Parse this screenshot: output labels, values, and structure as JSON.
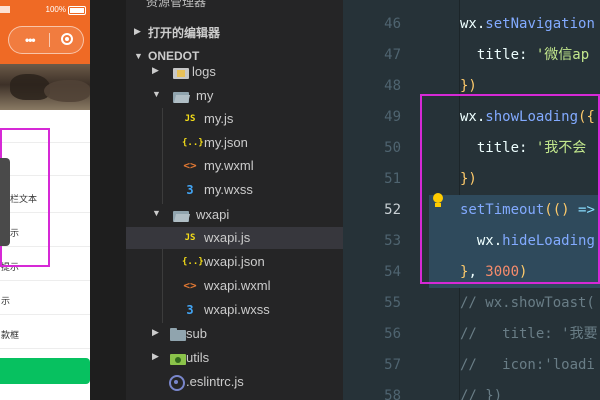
{
  "phone": {
    "battery_text": "100%",
    "list_items": [
      "",
      "",
      "题栏文本",
      "提示",
      "提示",
      "示",
      "款框"
    ]
  },
  "explorer": {
    "section_truncated": "资源管理器",
    "open_editors": "打开的编辑器",
    "project": "ONEDOT",
    "tree": [
      {
        "name": "logs",
        "type": "folder-logs",
        "expanded": false
      },
      {
        "name": "my",
        "type": "folder",
        "expanded": true
      },
      {
        "name": "my.js",
        "type": "js"
      },
      {
        "name": "my.json",
        "type": "json"
      },
      {
        "name": "my.wxml",
        "type": "wxml"
      },
      {
        "name": "my.wxss",
        "type": "wxss"
      },
      {
        "name": "wxapi",
        "type": "folder",
        "expanded": true
      },
      {
        "name": "wxapi.js",
        "type": "js",
        "selected": true
      },
      {
        "name": "wxapi.json",
        "type": "json"
      },
      {
        "name": "wxapi.wxml",
        "type": "wxml"
      },
      {
        "name": "wxapi.wxss",
        "type": "wxss"
      },
      {
        "name": "sub",
        "type": "folder",
        "expanded": false
      },
      {
        "name": "utils",
        "type": "folder-utils",
        "expanded": false
      },
      {
        "name": ".eslintrc.js",
        "type": "eslint"
      }
    ]
  },
  "editor": {
    "active_line": "52",
    "lines": [
      {
        "num": "46",
        "parts": [
          [
            "fn-prefix",
            "wx."
          ],
          [
            "fn",
            "setNavigation"
          ]
        ]
      },
      {
        "num": "47",
        "parts": [
          [
            "id",
            "  title: "
          ],
          [
            "str",
            "'微信ap"
          ]
        ]
      },
      {
        "num": "48",
        "parts": [
          [
            "b",
            "})"
          ]
        ]
      },
      {
        "num": "49",
        "parts": [
          [
            "fn-prefix",
            "wx."
          ],
          [
            "fn",
            "showLoading"
          ],
          [
            "b",
            "({"
          ]
        ]
      },
      {
        "num": "50",
        "parts": [
          [
            "id",
            "  title: "
          ],
          [
            "str",
            "'我不会"
          ]
        ]
      },
      {
        "num": "51",
        "parts": [
          [
            "b",
            "})"
          ]
        ]
      },
      {
        "num": "52",
        "parts": [
          [
            "fn",
            "setTimeout"
          ],
          [
            "b",
            "("
          ],
          [
            "b",
            "() "
          ],
          [
            "p",
            "=>"
          ]
        ],
        "sel": true
      },
      {
        "num": "53",
        "parts": [
          [
            "fn-prefix",
            "  wx."
          ],
          [
            "fn",
            "hideLoading"
          ]
        ],
        "sel": true
      },
      {
        "num": "54",
        "parts": [
          [
            "b",
            "}"
          ],
          [
            "id",
            ", "
          ],
          [
            "num",
            "3000"
          ],
          [
            "b",
            ")"
          ]
        ],
        "sel": true
      },
      {
        "num": "55",
        "parts": [
          [
            "cm",
            "// wx.showToast("
          ]
        ]
      },
      {
        "num": "56",
        "parts": [
          [
            "cm",
            "//   title: '我要"
          ]
        ]
      },
      {
        "num": "57",
        "parts": [
          [
            "cm",
            "//   icon:'loadi"
          ]
        ]
      },
      {
        "num": "58",
        "parts": [
          [
            "cm",
            "// })"
          ]
        ]
      }
    ]
  },
  "colors": {
    "accent_orange": "#ef6a25",
    "highlight_magenta": "#d629d6",
    "editor_bg": "#263238",
    "sidebar_bg": "#252526",
    "wechat_green": "#07c160"
  }
}
